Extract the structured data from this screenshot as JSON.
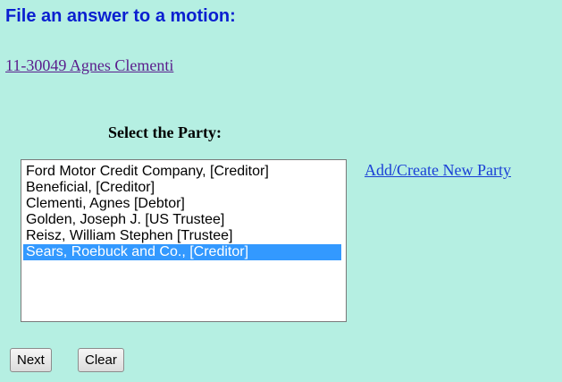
{
  "page_title": "File an answer to a motion:",
  "case_link": "11-30049 Agnes Clementi",
  "party_heading": "Select the Party:",
  "parties": [
    {
      "label": "Ford Motor Credit Company, [Creditor]",
      "selected": false
    },
    {
      "label": "Beneficial, [Creditor]",
      "selected": false
    },
    {
      "label": "Clementi, Agnes [Debtor]",
      "selected": false
    },
    {
      "label": "Golden, Joseph J. [US Trustee]",
      "selected": false
    },
    {
      "label": "Reisz, William Stephen [Trustee]",
      "selected": false
    },
    {
      "label": "Sears, Roebuck and Co., [Creditor]",
      "selected": true
    }
  ],
  "add_party_link": "Add/Create New Party",
  "buttons": {
    "next": "Next",
    "clear": "Clear"
  },
  "colors": {
    "background": "#b5efe2",
    "title": "#0a1fd0",
    "selection": "#3399ff"
  }
}
